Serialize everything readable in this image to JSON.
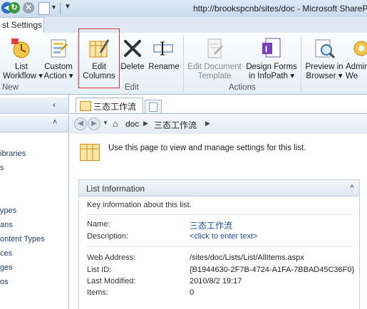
{
  "titlebar": {
    "title": "http://brookspcnb/sites/doc - Microsoft ShareP"
  },
  "ribbon": {
    "tab_label": "st Settings",
    "buttons": {
      "list_workflow": "List\nWorkflow ▾",
      "custom_action": "Custom\nAction ▾",
      "edit_columns": "Edit\nColumns",
      "delete": "Delete",
      "rename": "Rename",
      "edit_doc_template": "Edit Document\nTemplate",
      "design_forms": "Design Forms\nin InfoPath ▾",
      "preview": "Preview in\nBrowser ▾",
      "admin": "Admin\nWe"
    },
    "groups": {
      "new": "New",
      "edit": "Edit",
      "actions": "Actions"
    },
    "colors": {
      "highlight_border": "#d9312b"
    }
  },
  "leftnav": {
    "items": [
      "ibraries",
      "s",
      "ypes",
      "ans",
      "ontent Types",
      "ces",
      "ges",
      "os"
    ]
  },
  "tabs": {
    "doc_tab": "三态工作流"
  },
  "breadcrumb": {
    "root": "doc",
    "current": "三态工作流"
  },
  "main": {
    "intro": "Use this page to view and manage settings for this list.",
    "section_title": "List Information",
    "section_subtitle": "Key information about this list.",
    "name_label": "Name:",
    "name_value": "三态工作流",
    "description_label": "Description:",
    "description_value": "<click to enter text>",
    "web_address_label": "Web Address:",
    "web_address_value": "/sites/doc/Lists/List/AllItems.aspx",
    "list_id_label": "List ID:",
    "list_id_value": "{B1944630-2F7B-4724-A1FA-7BBAD45C36F0}",
    "last_modified_label": "Last Modified:",
    "last_modified_value": "2010/8/2 19:17",
    "items_label": "Items:",
    "items_value": "0"
  }
}
